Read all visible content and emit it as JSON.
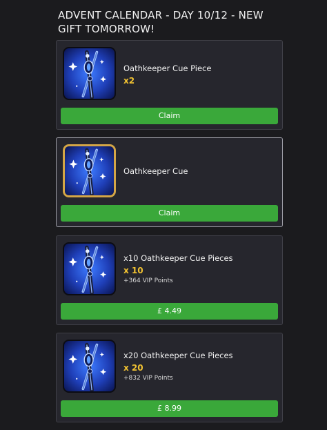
{
  "header": {
    "title": "ADVENT CALENDAR - DAY 10/12 - NEW GIFT TOMORROW!"
  },
  "items": [
    {
      "name": "Oathkeeper Cue Piece",
      "quantity": "x2",
      "vip": "",
      "button_label": "Claim",
      "icon": "oathkeeper-cue-icon",
      "frame": "dark"
    },
    {
      "name": "Oathkeeper Cue",
      "quantity": "",
      "vip": "",
      "button_label": "Claim",
      "icon": "oathkeeper-cue-icon",
      "frame": "gold"
    },
    {
      "name": "x10 Oathkeeper Cue Pieces",
      "quantity": "x 10",
      "vip": "+364 VIP Points",
      "button_label": "£ 4.49",
      "icon": "oathkeeper-cue-icon",
      "frame": "dark"
    },
    {
      "name": "x20 Oathkeeper Cue Pieces",
      "quantity": "x 20",
      "vip": "+832 VIP Points",
      "button_label": "£ 8.99",
      "icon": "oathkeeper-cue-icon",
      "frame": "dark"
    }
  ],
  "colors": {
    "background": "#1b1b1e",
    "card": "#26262d",
    "button_green": "#3aa83a",
    "quantity_gold": "#f1c232",
    "frame_gold": "#d4a646"
  }
}
